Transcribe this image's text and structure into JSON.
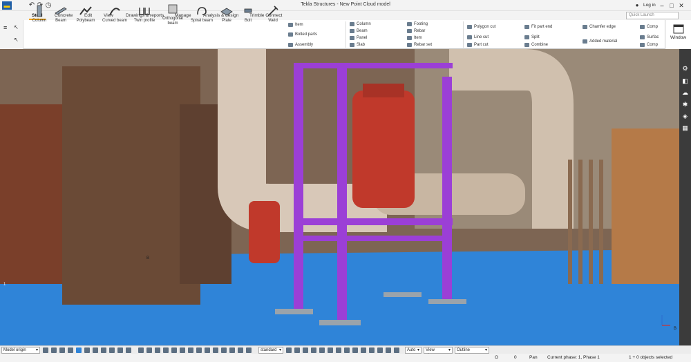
{
  "app": {
    "title": "Tekla Structures - New Point Cloud model",
    "login": "Log in",
    "quick_launch_placeholder": "Quick Launch"
  },
  "tabs": [
    "Steel",
    "Concrete",
    "Edit",
    "View",
    "Drawings & reports",
    "Manage",
    "Analysis & design",
    "Trimble Connect"
  ],
  "active_tab": "Steel",
  "ribbon": {
    "big_buttons": [
      "Column",
      "Beam",
      "Polybeam",
      "Curved beam",
      "Twin profile",
      "Orthogonal beam",
      "Spiral beam",
      "Plate",
      "Bolt",
      "Weld"
    ],
    "group1": [
      "Item",
      "Bolted parts",
      "Assembly"
    ],
    "group2": [
      "Column",
      "Beam",
      "Panel",
      "Slab"
    ],
    "group3": [
      "Footing",
      "Rebar",
      "Item",
      "Rebar set"
    ],
    "group4": [
      "Polygon cut",
      "Line cut",
      "Part cut"
    ],
    "group5": [
      "Fit part end",
      "Split",
      "Combine"
    ],
    "group6": [
      "Chamfer edge",
      "Added material"
    ],
    "group7": [
      "Comp",
      "Surfac",
      "Comp"
    ],
    "window_label": "Window"
  },
  "viewport": {
    "label_b1": "B",
    "label_1": "1",
    "label_b2": "B",
    "axis_label": "B"
  },
  "statusbar": {
    "origin": "Model origin",
    "snap_mode": "standard",
    "auto": "Auto",
    "view_plane": "View plane",
    "outline_planes": "Outline planes"
  },
  "bottom": {
    "o_label": "O",
    "zero": "0",
    "pan": "Pan",
    "phase": "Current phase: 1, Phase 1",
    "selected": "1 + 0 objects selected"
  },
  "colors": {
    "accent": "#f0a000",
    "steel": "#9b3fd6",
    "floor": "#2d82d6"
  }
}
